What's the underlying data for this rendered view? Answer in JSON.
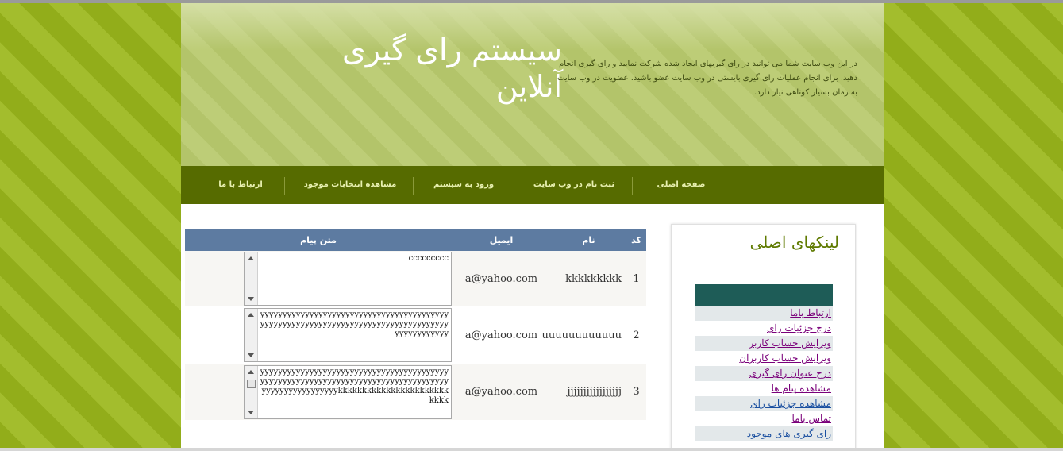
{
  "header": {
    "site_title": "سیستم رای گیری آنلاین",
    "description": "در این وب سایت شما می توانید در رای گیریهای ایجاد شده شرکت نمایید و رای گیری انجام دهید. برای انجام عملیات رای گیری بایستی در وب سایت عضو باشید. عضویت در وب سایت به زمان بسیار کوتاهی نیاز دارد."
  },
  "nav": {
    "items": [
      "صفحه اصلی",
      "ثبت نام در وب سایت",
      "ورود به سیستم",
      "مشاهده انتخابات موجود",
      "ارتباط با ما"
    ]
  },
  "table": {
    "headers": {
      "code": "کد",
      "name": "نام",
      "email": "ایمیل",
      "message": "متن پیام"
    },
    "rows": [
      {
        "code": "1",
        "name": "kkkkkkkkk",
        "email": "a@yahoo.com",
        "message": "ccccccccc"
      },
      {
        "code": "2",
        "name": "uuuuuuuuuuuu",
        "email": "a@yahoo.com",
        "message": "yyyyyyyyyyyyyyyyyyyyyyyyyyyyyyyyyyyyyyyyyyyyyyyyyyyyyyyyyyyyyyyyyyyyyyyyyyyyyyyyyyyyyyyyyyyyyyyy"
      },
      {
        "code": "3",
        "name": "jjjjjjjjjjjjjjjjj",
        "email": "a@yahoo.com",
        "message": "yyyyyyyyyyyyyyyyyyyyyyyyyyyyyyyyyyyyyyyyyyyyyyyyyyyyyyyyyyyyyyyyyyyyyyyyyyyyyyyyyyyyyyyyyyyyyyyyyyyyykkkkkkkkkkkkkkkkkkkkkkkkkkk"
      }
    ]
  },
  "sidebar": {
    "title": "لینکهای اصلی",
    "links": [
      {
        "label": "ارتباط باما",
        "color": "#7a007a"
      },
      {
        "label": "درج جزئیات رای",
        "color": "#7a007a"
      },
      {
        "label": "ویرایش حساب کاربر",
        "color": "#7a007a"
      },
      {
        "label": "ویرایش حساب کاربران",
        "color": "#7a007a"
      },
      {
        "label": "درج عنوان رای گیری",
        "color": "#7a007a"
      },
      {
        "label": "مشاهده پیام ها",
        "color": "#7a007a"
      },
      {
        "label": "مشاهده جزئیات رای",
        "color": "#1a4fa0"
      },
      {
        "label": "تماس باما",
        "color": "#7a007a"
      },
      {
        "label": "رای گیری های موجود",
        "color": "#1a4fa0"
      }
    ]
  },
  "colors": {
    "page_bg": "#9cb524",
    "header_bg": "#b8c972",
    "navbar_bg": "#566b00",
    "table_header_bg": "#5d7ba1",
    "sidebar_bar_bg": "#1e5c57",
    "sidebar_title": "#5f7a00"
  }
}
